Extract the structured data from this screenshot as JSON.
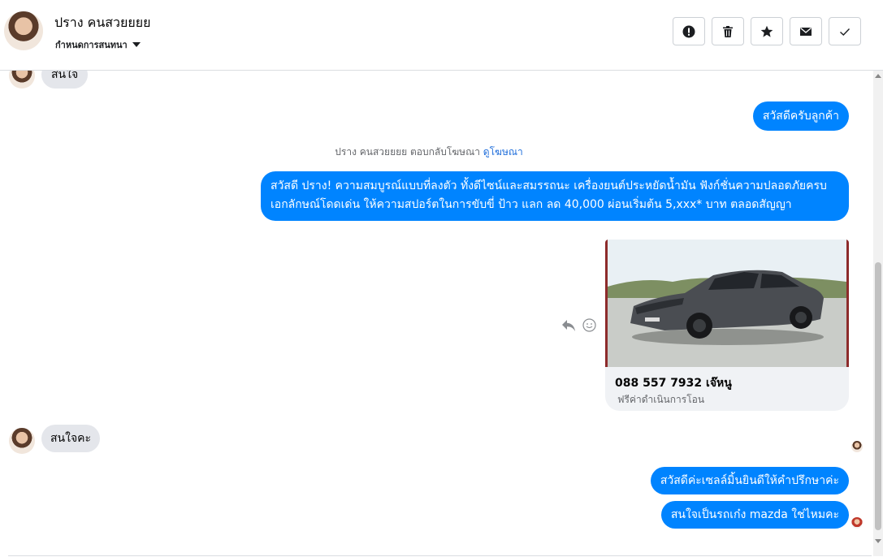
{
  "header": {
    "contact_name": "ปราง คนสวยยยย",
    "label_dropdown": "กำหนดการสนทนา",
    "actions": [
      "spam",
      "delete",
      "star",
      "mark-unread",
      "done"
    ]
  },
  "messages": {
    "m1_in": "สนใจ",
    "m2_out": "สวัสดีครับลูกค้า",
    "ad_notice_text": "ปราง คนสวยยยย ตอบกลับโฆษณา",
    "ad_notice_link": "ดูโฆษณา",
    "m3_out": "สวัสดี ปราง! ความสมบูรณ์แบบที่ลงตัว ทั้งดีไซน์และสมรรถนะ เครื่องยนต์ประหยัดน้ำมัน ฟังก์ชั่นความปลอดภัยครบ เอกลักษณ์โดดเด่น ให้ความสปอร์ตในการขับขี่ ป้าว แลก ลด 40,000 ผ่อนเริ่มต้น 5,xxx* บาท ตลอดสัญญา",
    "card_title": "088 557 7932 เจ๊หนู",
    "card_subtitle": "ฟรีค่าดำเนินการโอน",
    "m4_in": "สนใจคะ",
    "m5_out": "สวัสดีค่ะเซลล์มิ้นยินดีให้คำปรึกษาค่ะ",
    "m6_out": "สนใจเป็นรถเก๋ง mazda ใช่ไหมคะ"
  },
  "colors": {
    "outgoing_bubble": "#0084ff",
    "incoming_bubble": "#e4e6eb",
    "link": "#216fdb"
  }
}
